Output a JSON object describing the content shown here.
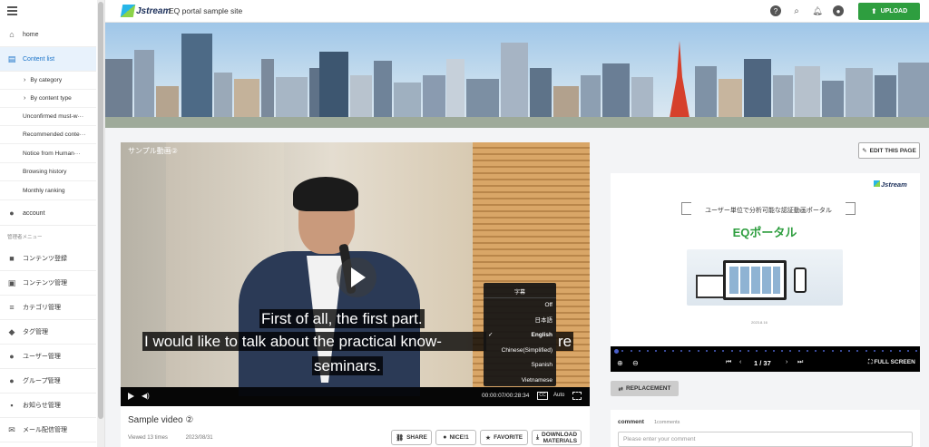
{
  "header": {
    "logo_text": "Jstream",
    "site_name": "EQ portal sample site",
    "upload_label": "UPLOAD",
    "icons": [
      "help-icon",
      "search-icon",
      "bell-icon",
      "account-icon"
    ]
  },
  "sidebar": {
    "items": [
      {
        "label": "home",
        "icon": "home-icon"
      },
      {
        "label": "Content list",
        "icon": "list-icon"
      },
      {
        "label": "account",
        "icon": "account-icon"
      }
    ],
    "subitems": [
      {
        "label": "By category"
      },
      {
        "label": "By content type"
      },
      {
        "label": "Unconfirmed must-w···"
      },
      {
        "label": "Recommended conte···"
      },
      {
        "label": "Notice from Human···"
      },
      {
        "label": "Browsing history"
      },
      {
        "label": "Monthly ranking"
      }
    ],
    "admin_section": "管理者メニュー",
    "admin_items": [
      {
        "label": "コンテンツ登録",
        "icon": "video-add-icon"
      },
      {
        "label": "コンテンツ管理",
        "icon": "library-icon"
      },
      {
        "label": "カテゴリ管理",
        "icon": "list-icon"
      },
      {
        "label": "タグ管理",
        "icon": "tag-icon"
      },
      {
        "label": "ユーザー管理",
        "icon": "users-icon"
      },
      {
        "label": "グループ管理",
        "icon": "group-icon"
      },
      {
        "label": "お知らせ管理",
        "icon": "announcement-icon"
      },
      {
        "label": "メール配信管理",
        "icon": "mail-icon"
      }
    ]
  },
  "video": {
    "overlay_title": "サンプル動画②",
    "captions": [
      "First of all, the first part.",
      "I would like to talk about the practical know-",
      "seminars."
    ],
    "caption_overlap": "re",
    "time": "00:00:07/00:28:34",
    "cc_label": "CC",
    "auto_label": "Auto",
    "subtitle_menu": {
      "heading": "字幕",
      "options": [
        "Off",
        "日本語",
        "English",
        "Chinese(Simplified)",
        "Spanish",
        "Vietnamese"
      ],
      "selected": "English"
    }
  },
  "info": {
    "title": "Sample video ②",
    "views": "Viewed 13 times",
    "date": "2023/08/31",
    "actions": {
      "share": "SHARE",
      "nice": "NICE!",
      "nice_count": "1",
      "favorite": "FAVORITE",
      "download_line1": "DOWNLOAD",
      "download_line2": "MATERIALS"
    }
  },
  "right": {
    "edit_label": "EDIT THIS PAGE",
    "slide": {
      "logo": "Jstream",
      "subtitle": "ユーザー単位で分析可能な認証動画ポータル",
      "title": "EQポータル",
      "date": "2023.8.16"
    },
    "slide_bar": {
      "page": "1 / 37",
      "full_screen": "FULL SCREEN"
    },
    "replacement_label": "REPLACEMENT",
    "comments": {
      "title": "comment",
      "count": "1comments",
      "placeholder": "Please enter your comment"
    }
  },
  "colors": {
    "upload_green": "#2e9e3f",
    "active_blue": "#1a73c8",
    "slide_title_green": "#2e9e3f"
  }
}
